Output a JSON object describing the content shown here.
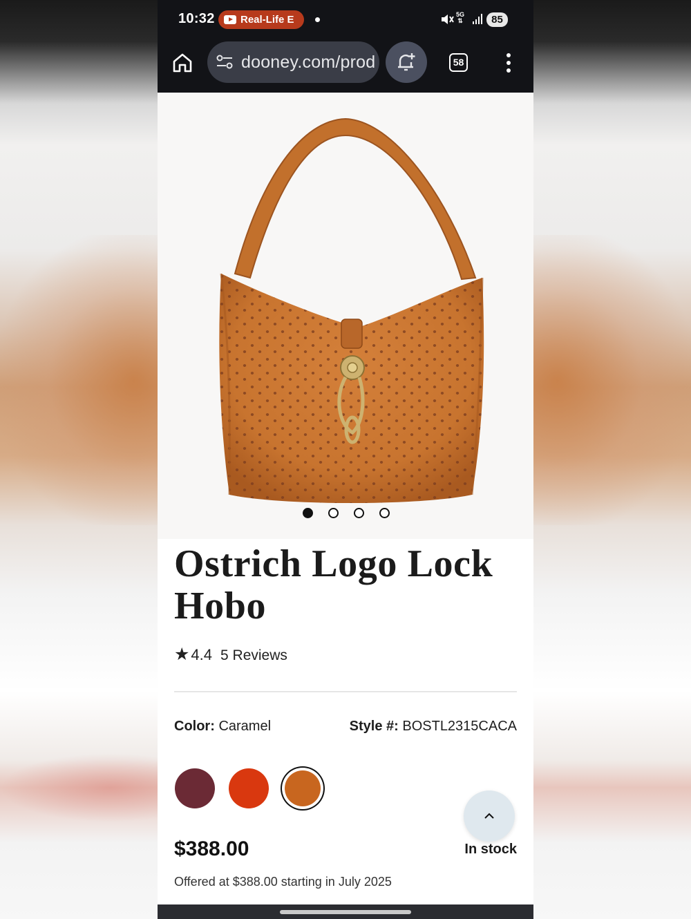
{
  "status_bar": {
    "time": "10:32",
    "notification_pill": "Real-Life E",
    "network_label": "5G",
    "battery": "85",
    "icons": [
      "youtube-icon",
      "mute-icon",
      "signal-icon"
    ]
  },
  "browser": {
    "url": "dooney.com/prod",
    "tab_count": "58",
    "icons": [
      "home-icon",
      "tune-icon",
      "notification-add-icon",
      "more-vert-icon"
    ]
  },
  "carousel": {
    "total": 4,
    "active_index": 0
  },
  "product": {
    "title": "Ostrich Logo Lock Hobo",
    "rating": "4.4",
    "reviews": "5 Reviews",
    "color_label": "Color:",
    "color_value": "Caramel",
    "style_label": "Style #:",
    "style_value": "BOSTL2315CACA",
    "swatches": [
      {
        "color": "#6b2a35",
        "selected": false
      },
      {
        "color": "#d9380f",
        "selected": false
      },
      {
        "color": "#c8661f",
        "selected": true
      }
    ],
    "price": "$388.00",
    "stock": "In stock",
    "offer_note": "Offered at $388.00 starting in July 2025"
  },
  "colors": {
    "bag": "#c8742f",
    "system_bar": "#121317",
    "url_pill": "#3a3d47"
  }
}
